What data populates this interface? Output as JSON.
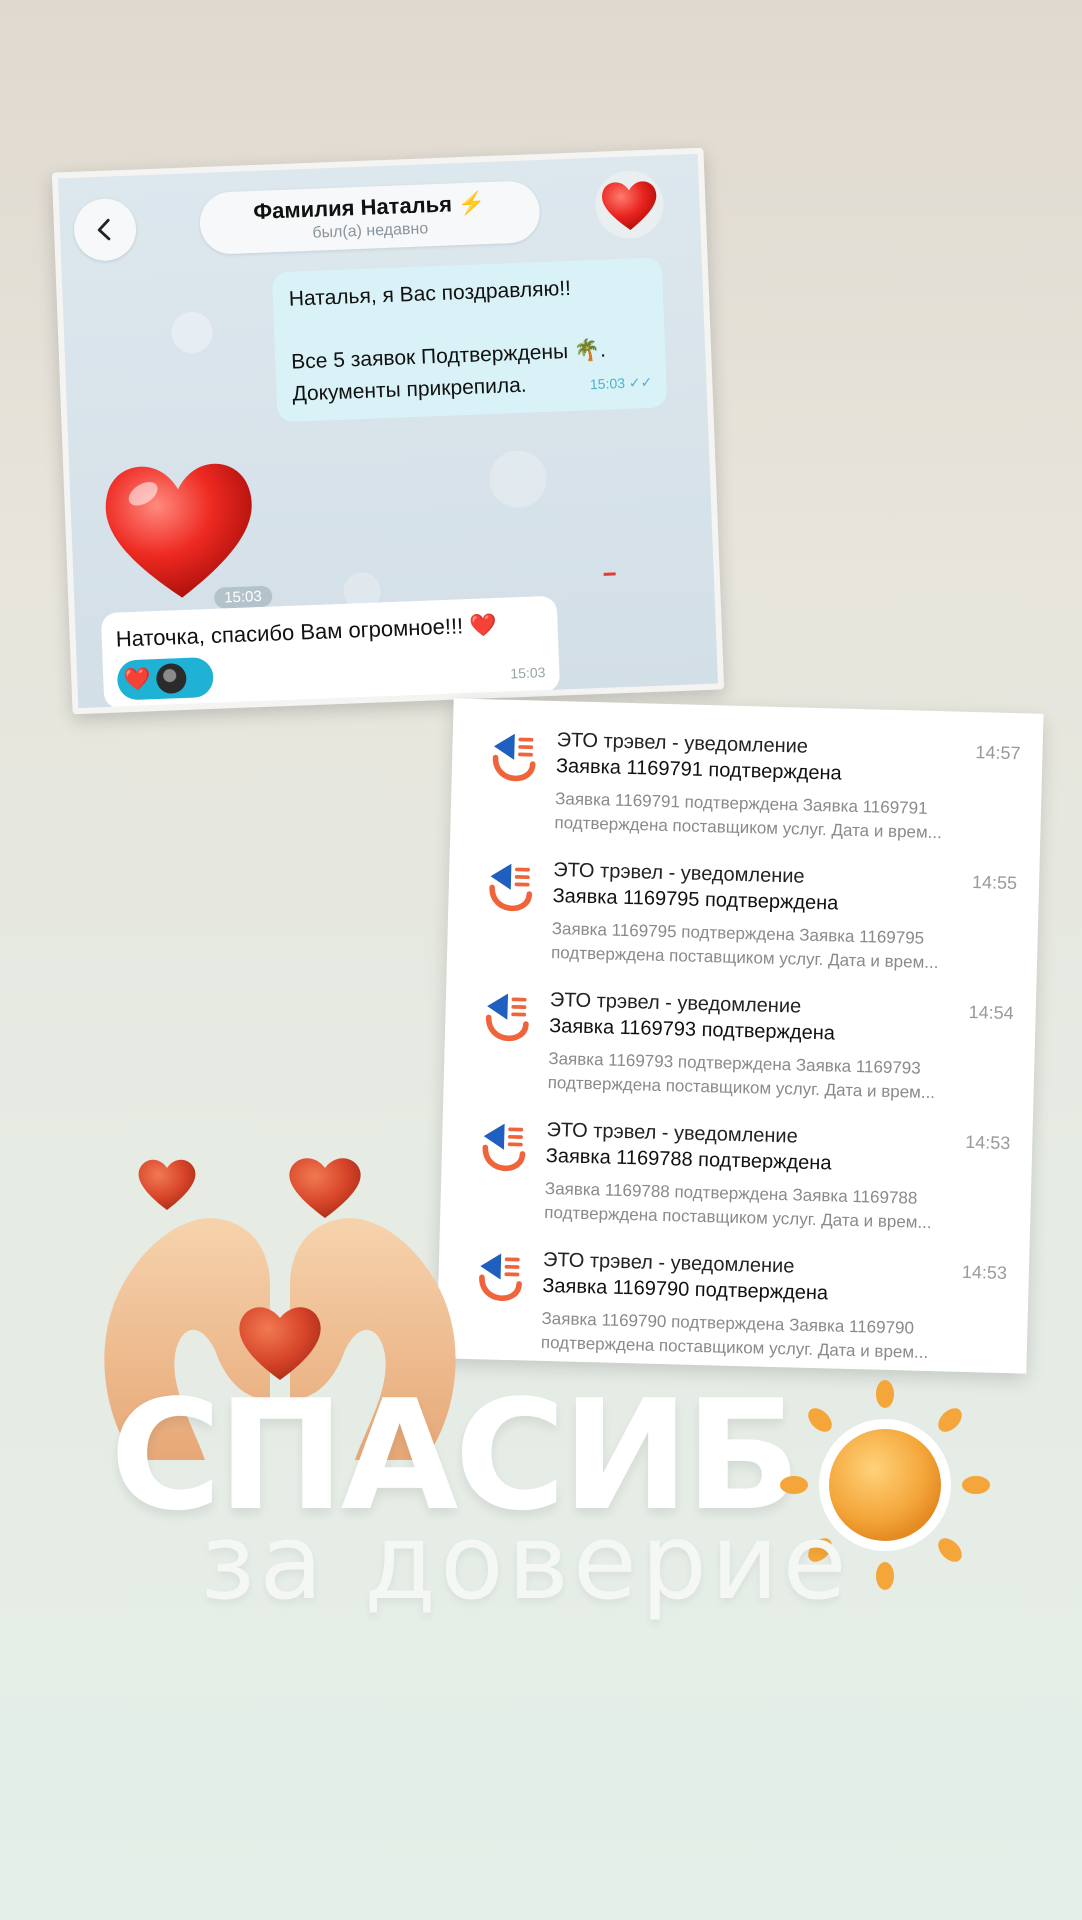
{
  "chat": {
    "contact_name": "Фамилия Наталья ⚡",
    "contact_status": "был(а) недавно",
    "outgoing": {
      "line1": "Наталья, я Вас поздравляю!!",
      "line2": "Все 5 заявок Подтверждены 🌴.",
      "line3": "Документы прикрепила.",
      "time": "15:03 ✓✓"
    },
    "sticker_time": "15:03",
    "incoming": {
      "text": "Наточка, спасибо Вам огромное!!! ❤️",
      "time": "15:03",
      "reaction_emoji": "❤️"
    },
    "colors": {
      "outgoing_bubble": "#d9f2f8",
      "reaction": "#1fb2d4"
    }
  },
  "notifications": [
    {
      "app": "ЭТО трэвел - уведомление",
      "title": "Заявка 1169791 подтверждена",
      "body_line1": "Заявка 1169791 подтверждена Заявка 1169791",
      "body_line2": "подтверждена поставщиком услуг. Дата и врем...",
      "time": "14:57"
    },
    {
      "app": "ЭТО трэвел - уведомление",
      "title": "Заявка 1169795 подтверждена",
      "body_line1": "Заявка 1169795 подтверждена Заявка 1169795",
      "body_line2": "подтверждена поставщиком услуг. Дата и врем...",
      "time": "14:55"
    },
    {
      "app": "ЭТО трэвел - уведомление",
      "title": "Заявка 1169793 подтверждена",
      "body_line1": "Заявка 1169793 подтверждена Заявка 1169793",
      "body_line2": "подтверждена поставщиком услуг. Дата и врем...",
      "time": "14:54"
    },
    {
      "app": "ЭТО трэвел - уведомление",
      "title": "Заявка 1169788 подтверждена",
      "body_line1": "Заявка 1169788 подтверждена Заявка 1169788",
      "body_line2": "подтверждена поставщиком услуг. Дата и врем...",
      "time": "14:53"
    },
    {
      "app": "ЭТО трэвел - уведомление",
      "title": "Заявка 1169790 подтверждена",
      "body_line1": "Заявка 1169790 подтверждена Заявка 1169790",
      "body_line2": "подтверждена поставщиком услуг. Дата и врем...",
      "time": "14:53"
    }
  ],
  "thanks": {
    "big": "СПАСИБ",
    "sub": "за доверие"
  },
  "colors": {
    "app_icon_blue": "#1f5fbf",
    "app_icon_orange": "#f0643c",
    "heart_red": "#e8231f",
    "sun_orange": "#f4a63a"
  }
}
